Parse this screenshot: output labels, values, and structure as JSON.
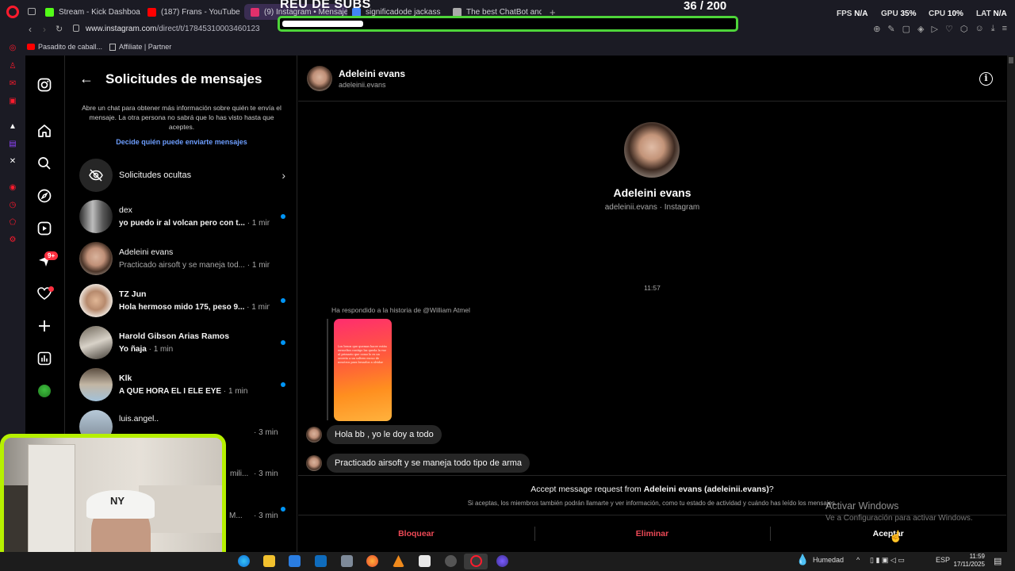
{
  "browser": {
    "tabs": [
      {
        "label": "Stream - Kick Dashboard",
        "color": "#53fc18"
      },
      {
        "label": "(187) Frans - YouTube",
        "color": "#ff0000"
      },
      {
        "label": "(9) Instagram • Mensajes",
        "color": "#e1306c"
      },
      {
        "label": "significadode jackass - B",
        "color": "#4285f4"
      },
      {
        "label": "The best ChatBot and W",
        "color": "#aaaaaa"
      }
    ],
    "url_host": "www.instagram.com",
    "url_path": "/direct/t/17845310003460123",
    "bookmarks": [
      "Pasadito de caball...",
      "Affiliate | Partner"
    ],
    "hud": {
      "fps_label": "FPS",
      "fps_value": "N/A",
      "gpu_label": "GPU",
      "gpu_value": "35%",
      "cpu_label": "CPU",
      "cpu_value": "10%",
      "lat_label": "LAT",
      "lat_value": "N/A"
    }
  },
  "overlay": {
    "subs_title": "REU DE SUBS",
    "subs_count": "36 / 200",
    "subs_progress": 0.18,
    "accent": "#4ed53a"
  },
  "instagram_nav": {
    "notif_badge": "9+"
  },
  "requests": {
    "title": "Solicitudes de mensajes",
    "description": "Abre un chat para obtener más información sobre quién te envía el mensaje. La otra persona no sabrá que lo has visto hasta que aceptes.",
    "link": "Decide quién puede enviarte mensajes",
    "hidden_label": "Solicitudes ocultas",
    "items": [
      {
        "name": "dex",
        "message": "yo puedo ir al volcan pero con t...",
        "time": "· 1 min",
        "unread": true
      },
      {
        "name": "Adeleini evans",
        "message": "Practicado airsoft y se maneja tod...",
        "time": "· 1 min",
        "unread": false
      },
      {
        "name": "TZ Jun",
        "message": "Hola hermoso mido 175, peso 9...",
        "time": "· 1 min",
        "unread": true
      },
      {
        "name": "Harold Gibson Arias Ramos",
        "message": "Yo ñaja",
        "time": "· 1 min",
        "unread": true
      },
      {
        "name": "Klk",
        "message": "A QUE HORA EL I ELE EYE",
        "time": "· 1 min",
        "unread": true
      },
      {
        "name": "luis.angel..",
        "message": "",
        "time": "· 3 min",
        "unread": false
      },
      {
        "name": "",
        "message": "mili...",
        "time": "· 3 min",
        "unread": false
      },
      {
        "name": "",
        "message": "M...",
        "time": "· 3 min",
        "unread": true
      }
    ]
  },
  "chat": {
    "name": "Adeleini evans",
    "handle": "adeleinii.evans",
    "profile_sub": "adeleinii.evans · Instagram",
    "time": "11:57",
    "replied_label": "Ha respondido a la historia de @William Atmel",
    "story_text": "Los besos que quemas hacer están envueltos contigo las queda la voz al primario que como lo es un secreto a un soltero escuo de nosotros para besarlos a olvidar",
    "messages": [
      "Hola bb , yo le doy a todo",
      "Practicado airsoft y se maneja todo tipo de arma"
    ],
    "accept_prefix": "Accept message request from",
    "accept_name": "Adeleini evans (adeleinii.evans)",
    "accept_suffix": "?",
    "accept_desc": "Si aceptas, los miembros también podrán llamarte y ver información, como tu estado de actividad y cuándo has leído los mensajes.",
    "actions": {
      "block": "Bloquear",
      "delete": "Eliminar",
      "accept": "Aceptar"
    }
  },
  "windows": {
    "watermark_title": "Activar Windows",
    "watermark_sub": "Ve a Configuración para activar Windows.",
    "weather": "Humedad",
    "lang": "ESP",
    "time": "11:59",
    "date": "17/11/2025"
  }
}
